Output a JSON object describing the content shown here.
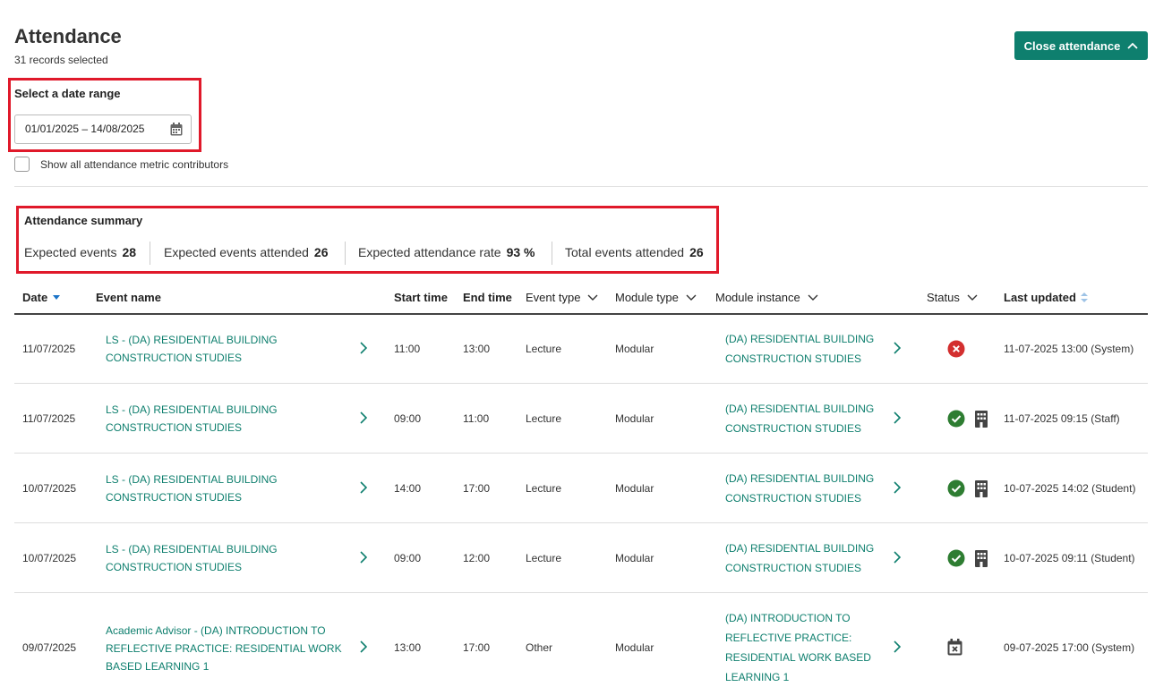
{
  "header": {
    "title": "Attendance",
    "subtitle": "31 records selected",
    "close_button": "Close attendance"
  },
  "date_range": {
    "label": "Select a date range",
    "value": "01/01/2025 – 14/08/2025"
  },
  "checkbox": {
    "label": "Show all attendance metric contributors",
    "checked": false
  },
  "summary": {
    "title": "Attendance summary",
    "metrics": [
      {
        "label": "Expected events",
        "value": "28"
      },
      {
        "label": "Expected events attended",
        "value": "26"
      },
      {
        "label": "Expected attendance rate",
        "value": "93 %"
      },
      {
        "label": "Total events attended",
        "value": "26"
      }
    ]
  },
  "table": {
    "columns": {
      "date": "Date",
      "event_name": "Event name",
      "start_time": "Start time",
      "end_time": "End time",
      "event_type": "Event type",
      "module_type": "Module type",
      "module_instance": "Module instance",
      "status": "Status",
      "last_updated": "Last updated"
    },
    "rows": [
      {
        "date": "11/07/2025",
        "event_line1": "LS - (DA) RESIDENTIAL BUILDING",
        "event_line2": "CONSTRUCTION STUDIES",
        "event_line3": "",
        "start": "11:00",
        "end": "13:00",
        "type": "Lecture",
        "module_type": "Modular",
        "instance_line1": "(DA) RESIDENTIAL BUILDING",
        "instance_line2": "CONSTRUCTION STUDIES",
        "status": "absent",
        "updated": "11-07-2025 13:00 (System)"
      },
      {
        "date": "11/07/2025",
        "event_line1": "LS - (DA) RESIDENTIAL BUILDING",
        "event_line2": "CONSTRUCTION STUDIES",
        "event_line3": "",
        "start": "09:00",
        "end": "11:00",
        "type": "Lecture",
        "module_type": "Modular",
        "instance_line1": "(DA) RESIDENTIAL BUILDING",
        "instance_line2": "CONSTRUCTION STUDIES",
        "status": "present-on-site",
        "updated": "11-07-2025 09:15 (Staff)"
      },
      {
        "date": "10/07/2025",
        "event_line1": "LS - (DA) RESIDENTIAL BUILDING",
        "event_line2": "CONSTRUCTION STUDIES",
        "event_line3": "",
        "start": "14:00",
        "end": "17:00",
        "type": "Lecture",
        "module_type": "Modular",
        "instance_line1": "(DA) RESIDENTIAL BUILDING",
        "instance_line2": "CONSTRUCTION STUDIES",
        "status": "present-on-site",
        "updated": "10-07-2025 14:02 (Student)"
      },
      {
        "date": "10/07/2025",
        "event_line1": "LS - (DA) RESIDENTIAL BUILDING",
        "event_line2": "CONSTRUCTION STUDIES",
        "event_line3": "",
        "start": "09:00",
        "end": "12:00",
        "type": "Lecture",
        "module_type": "Modular",
        "instance_line1": "(DA) RESIDENTIAL BUILDING",
        "instance_line2": "CONSTRUCTION STUDIES",
        "status": "present-on-site",
        "updated": "10-07-2025 09:11 (Student)"
      },
      {
        "date": "09/07/2025",
        "event_line1": "Academic Advisor - (DA) INTRODUCTION TO",
        "event_line2": "REFLECTIVE PRACTICE: RESIDENTIAL WORK",
        "event_line3": "BASED LEARNING 1",
        "start": "13:00",
        "end": "17:00",
        "type": "Other",
        "module_type": "Modular",
        "instance_line1": "(DA) INTRODUCTION TO",
        "instance_line2": "REFLECTIVE PRACTICE:",
        "instance_line3": "RESIDENTIAL WORK BASED",
        "instance_line4": "LEARNING 1",
        "status": "cancelled",
        "updated": "09-07-2025 17:00 (System)"
      }
    ]
  },
  "colors": {
    "accent": "#0e7f6e",
    "highlight": "#e0192a",
    "present": "#2e7d32",
    "absent": "#d32f2f"
  }
}
